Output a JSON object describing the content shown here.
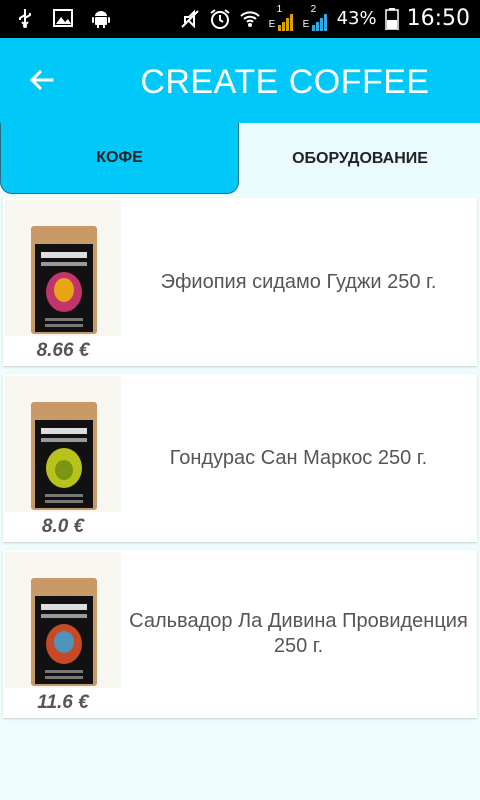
{
  "status_bar": {
    "sim1_label": "1",
    "sim2_label": "2",
    "network1": "E",
    "network2": "E",
    "battery": "43%",
    "time": "16:50",
    "icons": [
      "usb-icon",
      "image-icon",
      "android-icon",
      "muted-icon",
      "alarm-icon",
      "wifi-icon",
      "signal-icon",
      "battery-icon"
    ]
  },
  "header": {
    "title": "CREATE COFFEE",
    "back_icon": "arrow-left-icon"
  },
  "tabs": [
    {
      "label": "КОФЕ",
      "active": true
    },
    {
      "label": "ОБОРУДОВАНИЕ",
      "active": false
    }
  ],
  "products": [
    {
      "name": "Эфиопия сидамо Гуджи 250 г.",
      "price": "8.66 €",
      "label_color": "#e23b7a"
    },
    {
      "name": "Гондурас Сан Маркос 250 г.",
      "price": "8.0 €",
      "label_color": "#d6e21f"
    },
    {
      "name": "Сальвадор Ла Дивина Провиденция 250 г.",
      "price": "11.6 €",
      "label_color": "#e8532b"
    }
  ],
  "colors": {
    "accent": "#00c8f8",
    "background": "#eefcfd",
    "text_muted": "#555555"
  }
}
